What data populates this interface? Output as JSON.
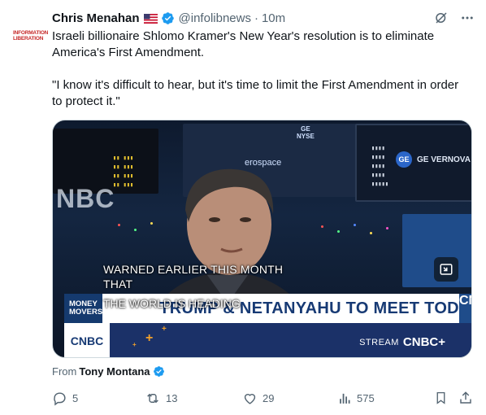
{
  "author": {
    "avatar_text": [
      "INFORMATION",
      "LIBERATION"
    ],
    "name": "Chris Menahan",
    "flag_icon": "us-flag-icon",
    "handle": "@infolibnews",
    "separator": "·",
    "time": "10m"
  },
  "tweet": {
    "line1": "Israeli billionaire Shlomo Kramer's New Year's resolution is to eliminate America's First Amendment.",
    "line2": "\"I know it's difficult to hear, but it's time to limit the First Amendment in order to protect it.\""
  },
  "video": {
    "wall_logo": "NBC",
    "wall_aerospace": "erospace",
    "wall_nyse_top": "GE",
    "wall_nyse": "NYSE",
    "ge_logo": "GE",
    "ge_text": "GE VERNOVA",
    "caption_line1": "WARNED EARLIER THIS MONTH",
    "caption_line2": "THAT",
    "caption_line3": "THE WORLD IS",
    "caption_line4": "HEADING",
    "show_name_line1": "MONEY",
    "show_name_line2": "MOVERS",
    "headline": "TRUMP & NETANYAHU TO MEET TODAY",
    "side_text": "CN",
    "network_logo": "CNBC",
    "stream_label": "STREAM",
    "stream_brand": "CNBC+"
  },
  "attribution": {
    "prefix": "From",
    "name": "Tony Montana"
  },
  "actions": {
    "replies": "5",
    "reposts": "13",
    "likes": "29",
    "views": "575"
  },
  "colors": {
    "verified": "#1d9bf0",
    "muted": "#536471",
    "text": "#0f1419",
    "cnbc_blue": "#173a74"
  }
}
